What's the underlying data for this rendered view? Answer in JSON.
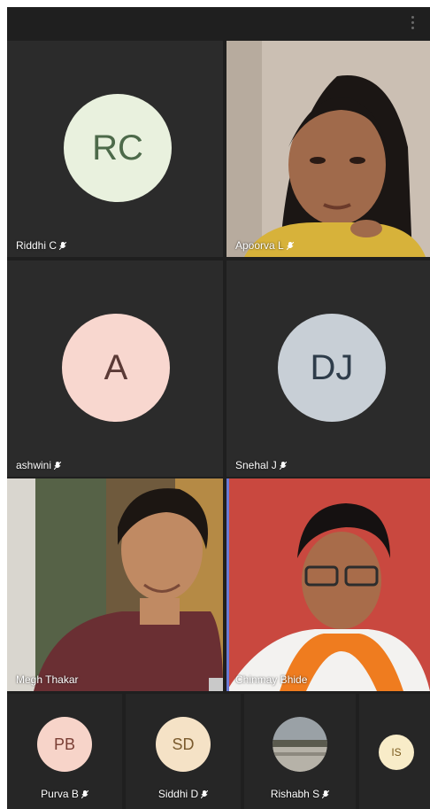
{
  "participants": [
    {
      "initials": "RC",
      "name": "Riddhi C",
      "avatar_bg": "#e9f1de",
      "avatar_fg": "#4d6a4a"
    },
    {
      "initials": "",
      "name": "Apoorva L",
      "video": true
    },
    {
      "initials": "A",
      "name": "ashwini",
      "avatar_bg": "#f8d7cf",
      "avatar_fg": "#5b3a36"
    },
    {
      "initials": "DJ",
      "name": "Snehal J",
      "avatar_bg": "#c8cfd6",
      "avatar_fg": "#2e3c4a"
    },
    {
      "initials": "",
      "name": "Megh Thakar",
      "video": true
    },
    {
      "initials": "",
      "name": "Chinmay Bhide",
      "video": true
    }
  ],
  "strip": [
    {
      "initials": "PB",
      "name": "Purva B",
      "avatar_bg": "#f7d4c9",
      "avatar_fg": "#7a3f35"
    },
    {
      "initials": "SD",
      "name": "Siddhi D",
      "avatar_bg": "#f5e2c6",
      "avatar_fg": "#7a5a2d"
    },
    {
      "initials": "",
      "name": "Rishabh S",
      "photo": true
    },
    {
      "initials": "IS",
      "name": "",
      "avatar_bg": "#f8ecc8",
      "avatar_fg": "#7a5a1d"
    }
  ],
  "icons": {
    "mic_off": "mic-off-icon",
    "more": "more-options-icon"
  }
}
